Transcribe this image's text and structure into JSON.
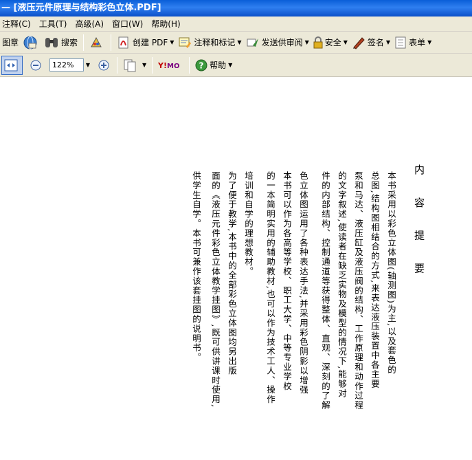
{
  "window": {
    "title": "— [液压元件原理与结构彩色立体.PDF]"
  },
  "menu": {
    "items": [
      "注释(C)",
      "工具(T)",
      "高级(A)",
      "窗口(W)",
      "帮助(H)"
    ]
  },
  "toolbar1": {
    "stamp": "图章",
    "search": "搜索",
    "create_pdf": "创建 PDF",
    "comment_mark": "注释和标记",
    "send_review": "发送供审阅",
    "security": "安全",
    "sign": "签名",
    "forms": "表单"
  },
  "toolbar2": {
    "zoom_value": "122%",
    "help": "帮助"
  },
  "document": {
    "heading": "内 容 提 要",
    "columns": [
      "本书采用以彩色立体图(轴测图)为主,以及套色的",
      "总图,结构图相结合的方式,来表达液压装置中各主要",
      "泵和马达、液压缸及液压阀的结构、工作原理和动作过程",
      "的文字叙述,使读者在缺乏实物及模型的情况下,能够对",
      "件的内部结构、控制通道等获得整体、直观、深刻的了解",
      "色立体图运用了各种表达手法,并采用彩色阴影以增强",
      "本书可以作为各高等学校、职工大学、中等专业学校",
      "的一本简明实用的辅助教材,也可以作为技术工人、操作",
      "培训和自学的理想教材。",
      "为了便于教学,本书中的全部彩色立体图均另出版",
      "面的《液压元件彩色立体教学挂图》,既可供讲课时使用,",
      "供学生自学。本书可兼作该套挂图的说明书。"
    ]
  },
  "colors": {
    "title_bg": "#0a5fd8",
    "chrome": "#ece9d8",
    "page": "#ffffff"
  }
}
